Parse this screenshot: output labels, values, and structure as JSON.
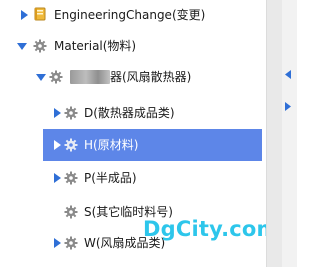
{
  "tree": {
    "nodes": [
      {
        "label": "EngineeringChange(变更)",
        "icon": "book-icon",
        "expander": "collapsed"
      },
      {
        "label": "Material(物料)",
        "icon": "gear-icon",
        "expander": "expanded"
      },
      {
        "label": "器(风扇散热器)",
        "icon": "gear-icon",
        "expander": "expanded",
        "redacted": true
      },
      {
        "label": "D(散热器成品类)",
        "icon": "gear-icon",
        "expander": "collapsed"
      },
      {
        "label": "H(原材料)",
        "icon": "gear-icon",
        "expander": "collapsed",
        "selected": true
      },
      {
        "label": "P(半成品)",
        "icon": "gear-icon",
        "expander": "collapsed"
      },
      {
        "label": "S(其它临时料号)",
        "icon": "gear-icon",
        "expander": "none"
      },
      {
        "label": "W(风扇成品类)",
        "icon": "gear-icon",
        "expander": "collapsed"
      }
    ]
  },
  "watermark": {
    "text": "DgCity.com"
  },
  "side_panel": {
    "arrows": [
      {
        "icon": "triangle-left-icon"
      },
      {
        "icon": "triangle-right-icon"
      }
    ]
  },
  "colors": {
    "selection": "#5d86e8",
    "expander": "#2f6fd6",
    "watermark": "#22c3ea"
  }
}
